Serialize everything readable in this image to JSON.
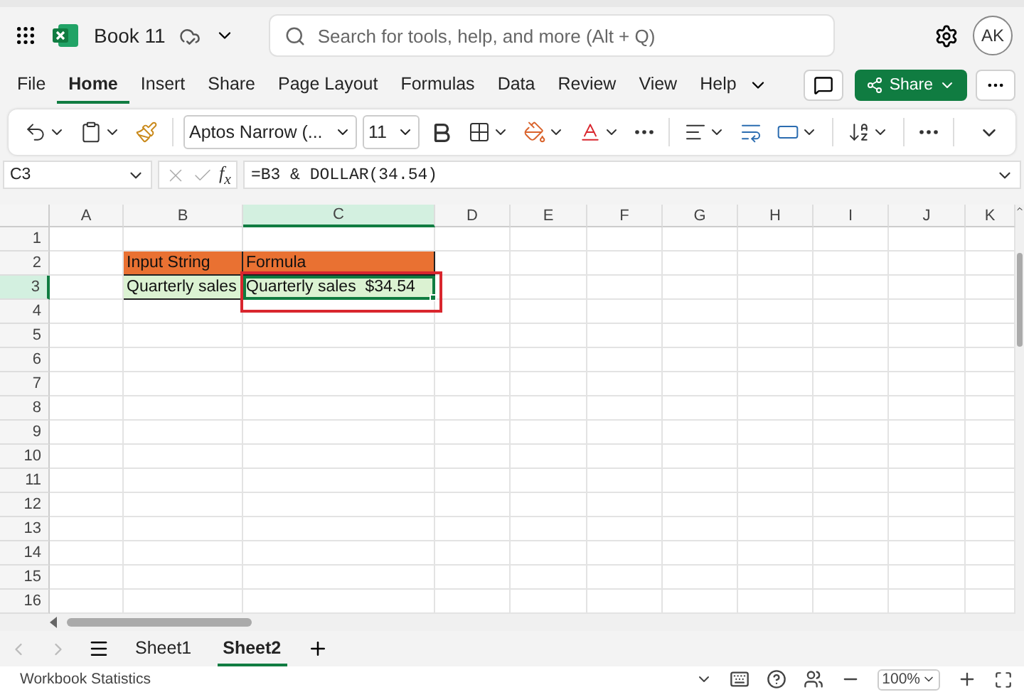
{
  "app_bar": {
    "document_title": "Book 11",
    "search": {
      "placeholder": "Search for tools, help, and more (Alt + Q)"
    },
    "avatar": "AK"
  },
  "menu_tabs": [
    {
      "label": "File",
      "selected": false
    },
    {
      "label": "Home",
      "selected": true
    },
    {
      "label": "Insert",
      "selected": false
    },
    {
      "label": "Share",
      "selected": false
    },
    {
      "label": "Page Layout",
      "selected": false
    },
    {
      "label": "Formulas",
      "selected": false
    },
    {
      "label": "Data",
      "selected": false
    },
    {
      "label": "Review",
      "selected": false
    },
    {
      "label": "View",
      "selected": false
    },
    {
      "label": "Help",
      "selected": false
    }
  ],
  "share_button": "Share",
  "ribbon": {
    "font_name": "Aptos Narrow (...",
    "font_size": "11"
  },
  "formula_bar": {
    "name_box": "C3",
    "function_symbol": "f$_{x}$",
    "formula": "=B3 & DOLLAR(34.54)"
  },
  "sheet": {
    "columns": [
      {
        "label": "A",
        "selected": false
      },
      {
        "label": "B",
        "selected": false
      },
      {
        "label": "C",
        "selected": true
      },
      {
        "label": "D",
        "selected": false
      },
      {
        "label": "E",
        "selected": false
      },
      {
        "label": "F",
        "selected": false
      },
      {
        "label": "G",
        "selected": false
      },
      {
        "label": "H",
        "selected": false
      },
      {
        "label": "I",
        "selected": false
      },
      {
        "label": "J",
        "selected": false
      },
      {
        "label": "K",
        "selected": false
      }
    ],
    "rows": [
      {
        "label": "1",
        "selected": false
      },
      {
        "label": "2",
        "selected": false,
        "cells": [
          {
            "kind": "empty"
          },
          {
            "kind": "header",
            "text": "Input String"
          },
          {
            "kind": "header",
            "text": "Formula"
          }
        ]
      },
      {
        "label": "3",
        "selected": true,
        "cells": [
          {
            "kind": "empty"
          },
          {
            "kind": "value",
            "text": "Quarterly sales"
          },
          {
            "kind": "value",
            "text": "Quarterly sales  $34.54",
            "selected": true,
            "annotated": true
          }
        ]
      },
      {
        "label": "4",
        "selected": false
      },
      {
        "label": "5",
        "selected": false
      },
      {
        "label": "6",
        "selected": false
      },
      {
        "label": "7",
        "selected": false
      },
      {
        "label": "8",
        "selected": false
      },
      {
        "label": "9",
        "selected": false
      },
      {
        "label": "10",
        "selected": false
      },
      {
        "label": "11",
        "selected": false
      },
      {
        "label": "12",
        "selected": false
      },
      {
        "label": "13",
        "selected": false
      },
      {
        "label": "14",
        "selected": false
      },
      {
        "label": "15",
        "selected": false
      },
      {
        "label": "16",
        "selected": false
      }
    ]
  },
  "sheet_tabs": [
    {
      "label": "Sheet1",
      "selected": false
    },
    {
      "label": "Sheet2",
      "selected": true
    }
  ],
  "status_bar": {
    "label": "Workbook Statistics",
    "zoom": "100%"
  }
}
